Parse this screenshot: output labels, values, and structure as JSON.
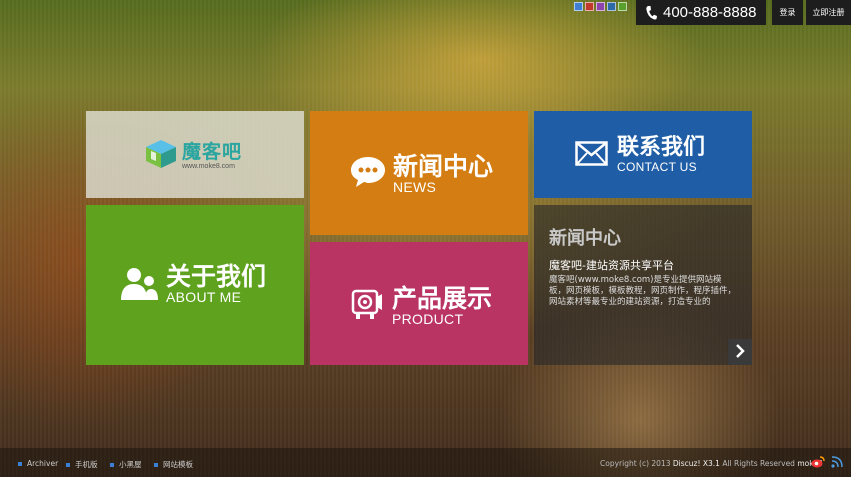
{
  "header": {
    "skin_colors": [
      "#3f7fd1",
      "#c0392b",
      "#8e44ad",
      "#2c6aa8",
      "#5aa02c"
    ],
    "phone": "400-888-8888",
    "login": "登录",
    "register": "立即注册"
  },
  "tiles": {
    "logo": {
      "name": "魔客吧",
      "url": "www.moke8.com"
    },
    "about": {
      "title": "关于我们",
      "subtitle": "ABOUT ME"
    },
    "news": {
      "title": "新闻中心",
      "subtitle": "NEWS"
    },
    "product": {
      "title": "产品展示",
      "subtitle": "PRODUCT"
    },
    "contact": {
      "title": "联系我们",
      "subtitle": "CONTACT US"
    },
    "panel": {
      "title": "新闻中心",
      "subtitle": "魔客吧-建站资源共享平台",
      "description": "魔客吧(www.moke8.com)是专业提供网站模板，网页模板，模板教程，网页制作，程序插件，网站素材等最专业的建站资源，打造专业的"
    }
  },
  "footer": {
    "links": [
      "Archiver",
      "手机版",
      "小黑屋",
      "网站模板"
    ],
    "copyright_prefix": "Copyright (c) 2013",
    "copyright_product": "Discuz! X3.1",
    "copyright_rights": "All Rights Reserved",
    "copyright_owner": "moke8"
  },
  "colors": {
    "about": "#5fa21e",
    "news": "#d47d12",
    "product": "#b93463",
    "contact": "#1f5ea6",
    "footer_bullet": "#3b7fd6"
  }
}
